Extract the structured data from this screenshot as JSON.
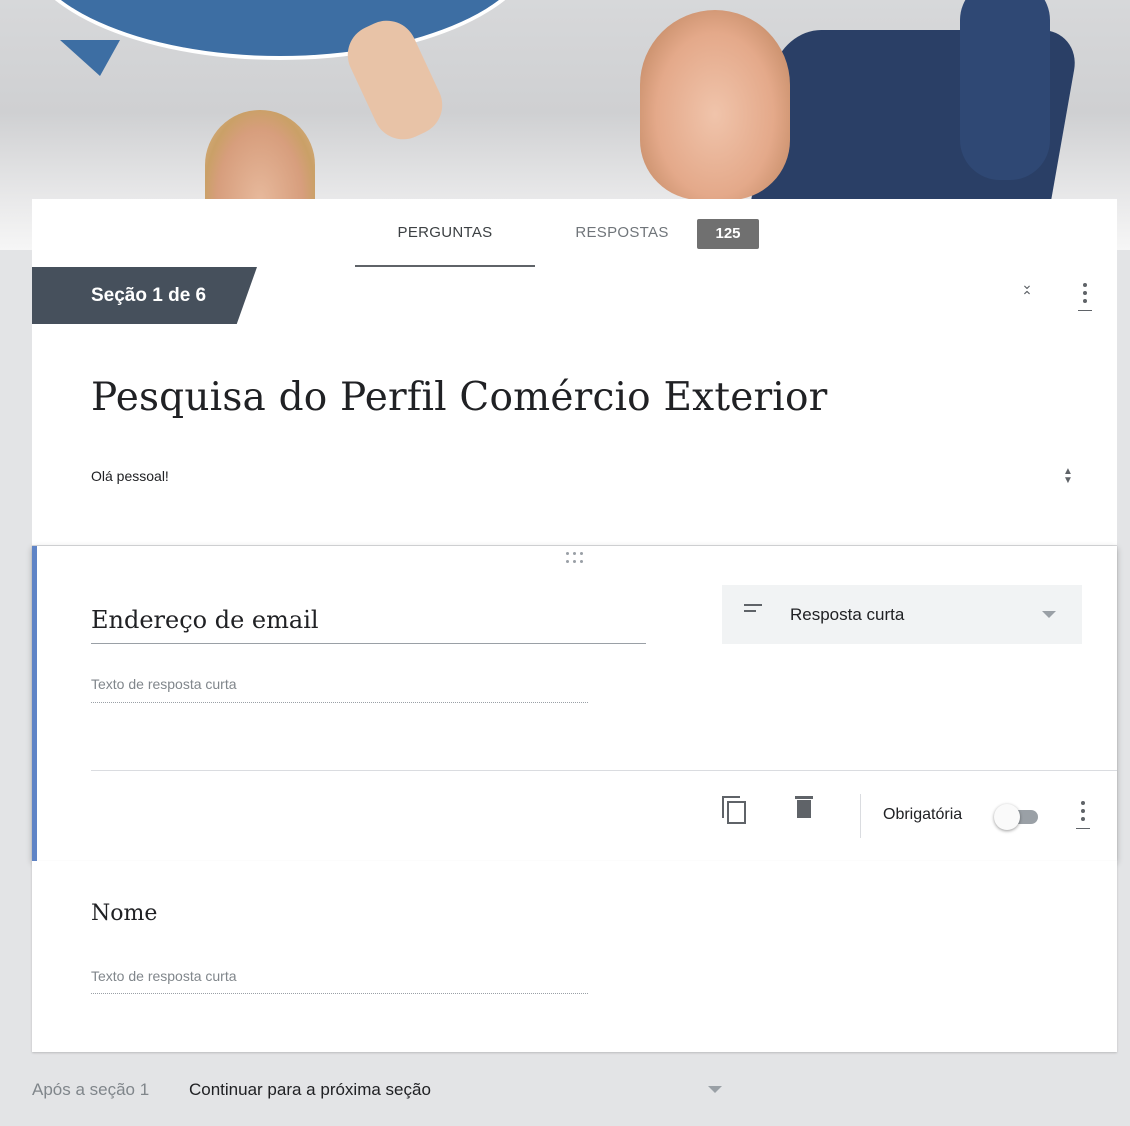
{
  "tabs": [
    {
      "label": "PERGUNTAS",
      "active": true
    },
    {
      "label": "RESPOSTAS",
      "active": false
    }
  ],
  "responses_count": "125",
  "section": {
    "label": "Seção 1 de 6",
    "title": "Pesquisa do Perfil Comércio Exterior",
    "description": "Olá pessoal!"
  },
  "questions": [
    {
      "title": "Endereço de email",
      "placeholder": "Texto de resposta curta",
      "type_label": "Resposta curta",
      "type_icon": "short-answer-icon",
      "required_label": "Obrigatória",
      "required": false
    },
    {
      "title": "Nome",
      "placeholder": "Texto de resposta curta"
    }
  ],
  "after_section": {
    "label": "Após a seção 1",
    "value": "Continuar para a próxima seção"
  },
  "colors": {
    "accent": "#5f84c6",
    "section_label_bg": "#46505c",
    "badge_bg": "#707070",
    "page_bg": "#e3e4e6"
  }
}
